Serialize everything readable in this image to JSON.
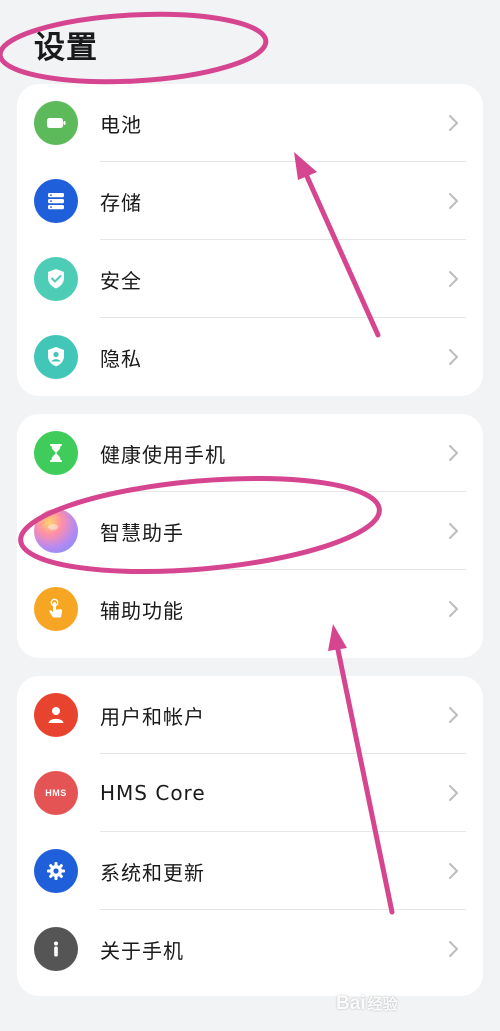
{
  "page": {
    "title": "设置"
  },
  "groups": [
    {
      "items": [
        {
          "label": "电池",
          "icon": "battery-icon",
          "color": "#5cba5b"
        },
        {
          "label": "存储",
          "icon": "storage-icon",
          "color": "#1f5fd9"
        },
        {
          "label": "安全",
          "icon": "shield-icon",
          "color": "#4ecdb6"
        },
        {
          "label": "隐私",
          "icon": "privacy-icon",
          "color": "#41c6b8"
        }
      ]
    },
    {
      "items": [
        {
          "label": "健康使用手机",
          "icon": "hourglass-icon",
          "color": "#3fcc5a"
        },
        {
          "label": "智慧助手",
          "icon": "assistant-orb-icon",
          "color": "#b78af0"
        },
        {
          "label": "辅助功能",
          "icon": "hand-touch-icon",
          "color": "#f6a623"
        }
      ]
    },
    {
      "items": [
        {
          "label": "用户和帐户",
          "icon": "user-icon",
          "color": "#e8432e"
        },
        {
          "label": "HMS Core",
          "icon": "hms-icon",
          "icon_text": "HMS",
          "color": "#e45454"
        },
        {
          "label": "系统和更新",
          "icon": "gear-icon",
          "color": "#1f5fd9"
        },
        {
          "label": "关于手机",
          "icon": "info-icon",
          "color": "#555555"
        }
      ]
    }
  ],
  "watermark": {
    "text": "Bai",
    "suffix": "经验"
  },
  "annotation_color": "#d6458f"
}
